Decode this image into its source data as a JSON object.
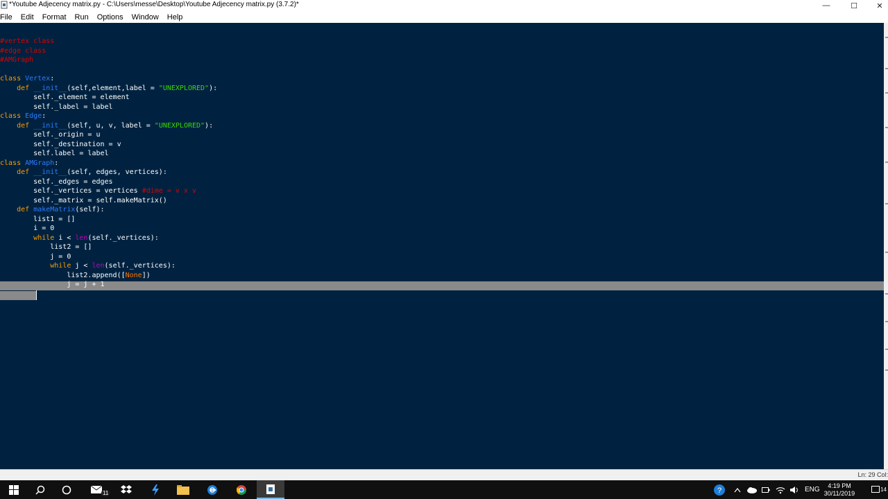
{
  "window": {
    "title": "*Youtube Adjecency matrix.py - C:\\Users\\messe\\Desktop\\Youtube Adjecency matrix.py (3.7.2)*",
    "minimize_glyph": "—",
    "maximize_glyph": "☐",
    "close_glyph": "✕"
  },
  "menu": {
    "items": [
      "File",
      "Edit",
      "Format",
      "Run",
      "Options",
      "Window",
      "Help"
    ]
  },
  "code": {
    "lines": [
      "#vertex class",
      "#edge class",
      "#AMGraph",
      "",
      "class Vertex:",
      "    def __init__(self,element,label = \"UNEXPLORED\"):",
      "        self._element = element",
      "        self._label = label",
      "class Edge:",
      "    def __init__(self, u, v, label = \"UNEXPLORED\"):",
      "        self._origin = u",
      "        self._destination = v",
      "        self.label = label",
      "class AMGraph:",
      "    def __init__(self, edges, vertices):",
      "        self._edges = edges",
      "        self._vertices = vertices #dime = v x v",
      "        self._matrix = self.makeMatrix()",
      "    def makeMatrix(self):",
      "        list1 = []",
      "        i = 0",
      "        while i < len(self._vertices):",
      "            list2 = []",
      "            j = 0",
      "            while j < len(self._vertices):",
      "                list2.append([None])",
      "                j = j + 1",
      ""
    ]
  },
  "status": {
    "position": "Ln: 29  Col:"
  },
  "taskbar": {
    "start_icon": "windows-start-icon",
    "search_icon": "search-icon",
    "cortana_icon": "cortana-icon",
    "mail_badge": "11",
    "language": "ENG",
    "time": "4:19 PM",
    "date": "30/11/2019",
    "notification_count": "14"
  },
  "colors": {
    "editor_bg": "#002240",
    "comment": "#dd0000",
    "keyword": "#ff9d00",
    "defname": "#2f7bff",
    "string": "#3ad900",
    "builtin": "#c000c0",
    "selection": "#8a8a8a"
  }
}
